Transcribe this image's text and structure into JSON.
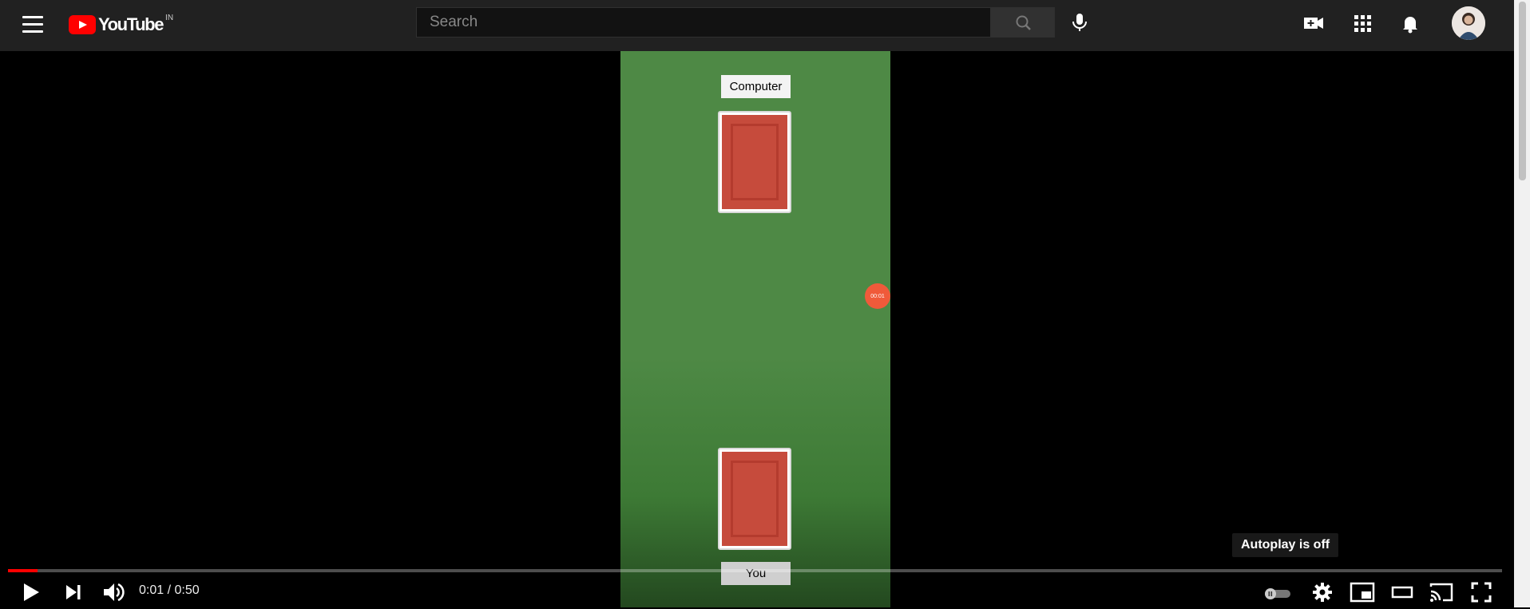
{
  "header": {
    "logo_text": "YouTube",
    "region": "IN",
    "search_placeholder": "Search"
  },
  "video": {
    "game": {
      "computer_label": "Computer",
      "player_label": "You",
      "timer": "00:01",
      "card_color": "#c64b3c",
      "table_color": "#4e8945"
    },
    "autoplay_tooltip": "Autoplay is off",
    "time_current": "0:01",
    "time_separator": " / ",
    "time_total": "0:50",
    "progress_fraction": 0.02
  },
  "colors": {
    "brand_red": "#ff0000",
    "header_bg": "#212121"
  }
}
